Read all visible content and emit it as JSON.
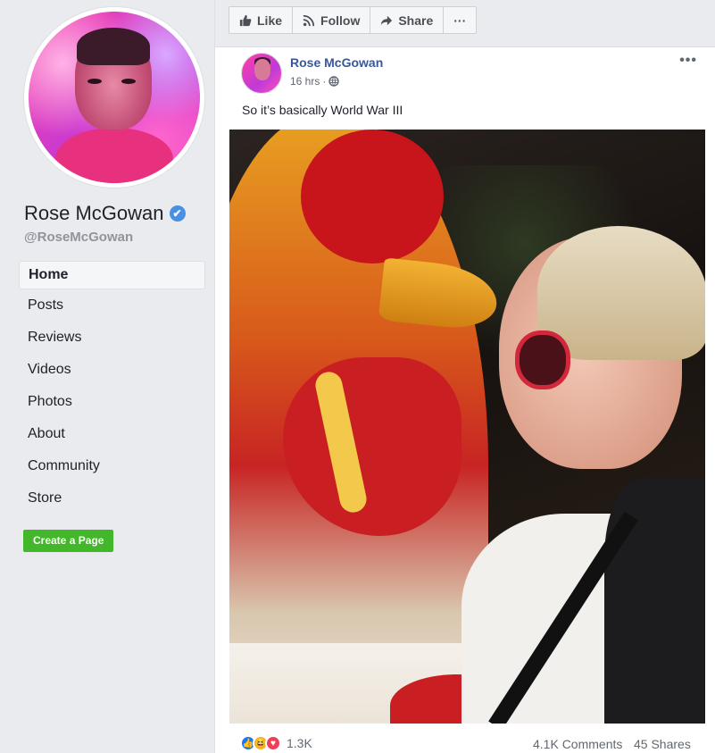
{
  "page": {
    "name": "Rose McGowan",
    "handle": "@RoseMcGowan",
    "verified_badge": "✔"
  },
  "sidebar": {
    "items": [
      {
        "label": "Home",
        "active": true
      },
      {
        "label": "Posts"
      },
      {
        "label": "Reviews"
      },
      {
        "label": "Videos"
      },
      {
        "label": "Photos"
      },
      {
        "label": "About"
      },
      {
        "label": "Community"
      },
      {
        "label": "Store"
      }
    ],
    "create_page_label": "Create a Page"
  },
  "actionbar": {
    "like_label": "Like",
    "follow_label": "Follow",
    "share_label": "Share",
    "more_label": "···"
  },
  "post": {
    "author": "Rose McGowan",
    "time": "16 hrs",
    "separator": "·",
    "text": "So it’s basically World War III",
    "menu_label": "•••",
    "reactions": {
      "like_icon": "👍",
      "haha_icon": "😆",
      "love_icon": "♥",
      "count": "1.3K"
    },
    "comments": "4.1K Comments",
    "shares": "45 Shares"
  },
  "colors": {
    "link_blue": "#385898",
    "create_green": "#42b72a",
    "background": "#e9ebee"
  }
}
